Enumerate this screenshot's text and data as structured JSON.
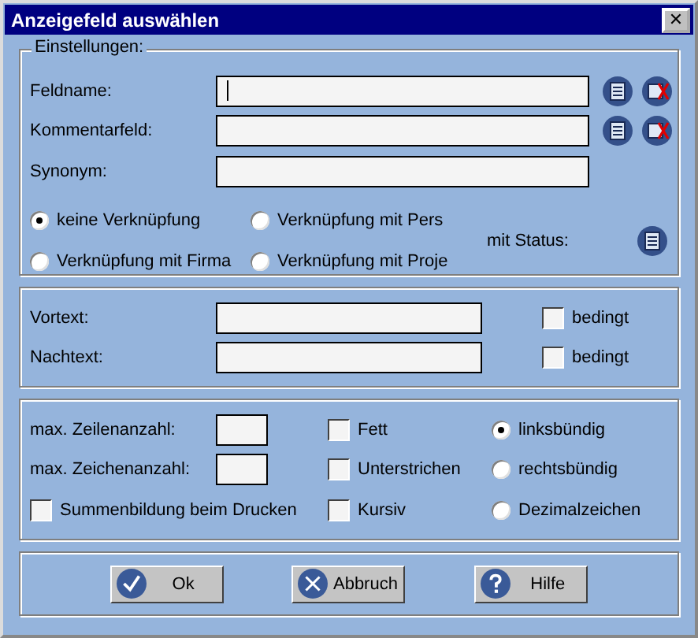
{
  "window": {
    "title": "Anzeigefeld auswählen",
    "close": "✕"
  },
  "settings": {
    "legend": "Einstellungen:",
    "fields": [
      {
        "label": "Feldname:",
        "focused": true,
        "actions": [
          {
            "kind": "list"
          },
          {
            "kind": "clear"
          }
        ]
      },
      {
        "label": "Kommentarfeld:",
        "focused": false,
        "actions": [
          {
            "kind": "list"
          },
          {
            "kind": "clear"
          }
        ]
      },
      {
        "label": "Synonym:",
        "focused": false
      }
    ],
    "links": [
      {
        "label": "keine Verknüpfung",
        "selected": true
      },
      {
        "label": "Verknüpfung mit Pers",
        "selected": false
      },
      {
        "label": "Verknüpfung mit Firma",
        "selected": false
      },
      {
        "label": "Verknüpfung mit Proje",
        "selected": false
      }
    ],
    "status": {
      "label": "mit Status:",
      "action": {
        "kind": "list"
      }
    }
  },
  "texts": [
    {
      "label": "Vortext:",
      "conditional": {
        "label": "bedingt",
        "checked": false
      }
    },
    {
      "label": "Nachtext:",
      "conditional": {
        "label": "bedingt",
        "checked": false
      }
    }
  ],
  "format": {
    "limits": [
      {
        "label": "max. Zeilenanzahl:"
      },
      {
        "label": "max. Zeichenanzahl:"
      }
    ],
    "sum": {
      "label": "Summenbildung beim Drucken",
      "checked": false
    },
    "styles": [
      {
        "label": "Fett",
        "checked": false
      },
      {
        "label": "Unterstrichen",
        "checked": false
      },
      {
        "label": "Kursiv",
        "checked": false
      }
    ],
    "alignment": [
      {
        "label": "linksbündig",
        "selected": true
      },
      {
        "label": "rechtsbündig",
        "selected": false
      },
      {
        "label": "Dezimalzeichen",
        "selected": false
      }
    ]
  },
  "buttons": [
    {
      "label": "Ok",
      "kind": "ok"
    },
    {
      "label": "Abbruch",
      "kind": "cancel"
    },
    {
      "label": "Hilfe",
      "kind": "help"
    }
  ]
}
